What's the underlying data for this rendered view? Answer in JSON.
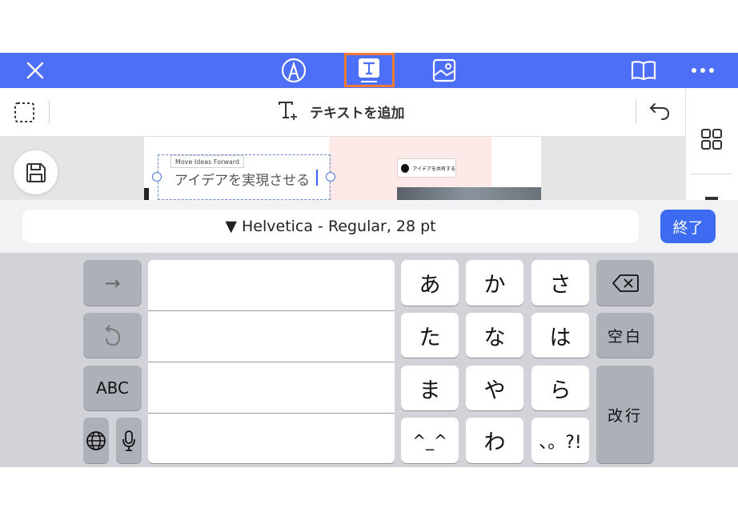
{
  "toolbar": {
    "icons": [
      "close-icon",
      "pen-tool-icon",
      "text-tool-icon",
      "image-tool-icon",
      "book-icon",
      "more-icon"
    ],
    "accent_color": "#4d6ef7",
    "highlight_color": "#f07b33"
  },
  "subbar": {
    "add_text_label": "テキストを追加"
  },
  "canvas": {
    "small_label": "Move Ideas Forward",
    "heading": "アイデアを実現させる",
    "share_pill": "アイデアを共有する"
  },
  "font_bar": {
    "font_label": "▼ Helvetica - Regular, 28 pt",
    "done_label": "終了"
  },
  "keyboard": {
    "kana": [
      "あ",
      "か",
      "さ",
      "た",
      "な",
      "は",
      "ま",
      "や",
      "ら",
      "^_^",
      "わ",
      "、。?!"
    ],
    "abc_label": "ABC",
    "space_label": "空白",
    "return_label": "改行",
    "arrow_label": "→"
  }
}
